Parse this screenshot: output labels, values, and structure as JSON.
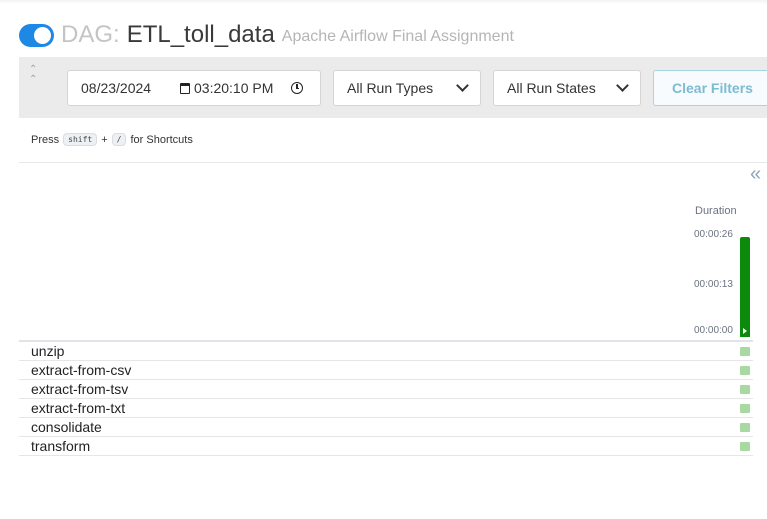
{
  "header": {
    "paused_toggle": "on",
    "prefix": "DAG:",
    "dag_id": "ETL_toll_data",
    "description": "Apache Airflow Final Assignment"
  },
  "filters": {
    "date": "08/23/2024",
    "time": "03:20:10 PM",
    "run_type": "All Run Types",
    "run_state": "All Run States",
    "clear_label": "Clear Filters"
  },
  "shortcuts": {
    "press": "Press",
    "key1": "shift",
    "plus": "+",
    "key2": "/",
    "suffix": "for Shortcuts"
  },
  "grid": {
    "duration_label": "Duration",
    "ticks": [
      "00:00:26",
      "00:00:13",
      "00:00:00"
    ],
    "run": {
      "duration_seconds": 26,
      "max_seconds": 26,
      "state": "success",
      "color": "#0c8a0c"
    },
    "tasks": [
      {
        "name": "unzip",
        "state": "success"
      },
      {
        "name": "extract-from-csv",
        "state": "success"
      },
      {
        "name": "extract-from-tsv",
        "state": "success"
      },
      {
        "name": "extract-from-txt",
        "state": "success"
      },
      {
        "name": "consolidate",
        "state": "success"
      },
      {
        "name": "transform",
        "state": "success"
      }
    ],
    "task_success_color": "#a9d9a2"
  },
  "colors": {
    "toggle": "#1e88e5",
    "clear_button_text": "#7cbcd3"
  }
}
